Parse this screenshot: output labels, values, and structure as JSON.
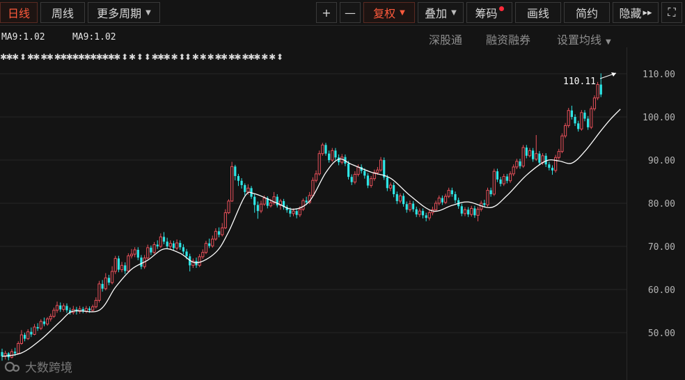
{
  "toolbar": {
    "tab_daily": "日线",
    "tab_weekly": "周线",
    "more_periods": "更多周期",
    "zoom_in": "+",
    "zoom_out": "—",
    "adjust": "复权",
    "overlay": "叠加",
    "chips": "筹码",
    "draw": "画线",
    "simple": "简约",
    "hide": "隐藏",
    "hide_arrow": "▸▸",
    "fullscreen": "⛶"
  },
  "indicator": {
    "ma_label_1": "MA9:1.02",
    "ma_label_2": "MA9:1.02"
  },
  "links": {
    "shenzhen_connect": "深股通",
    "margin_trading": "融资融券",
    "ma_settings": "设置均线"
  },
  "watermark": "大数跨境",
  "colors": {
    "background": "#141414",
    "up": "#e8505a",
    "down": "#2ee6e6",
    "ma_line": "#ffffff",
    "active": "#ff5a3c",
    "grid": "#262626"
  },
  "chart_data": {
    "type": "candlestick",
    "yticks": [
      "110.00",
      "100.00",
      "90.00",
      "80.00",
      "70.00",
      "60.00",
      "50.00"
    ],
    "ylim": [
      43,
      110
    ],
    "max_label": "110.11",
    "candles": [
      [
        45.5,
        44.5,
        46.3,
        43.5
      ],
      [
        44.5,
        45.2,
        45.8,
        43.8
      ],
      [
        45.2,
        44.3,
        45.5,
        43.6
      ],
      [
        44.3,
        45.6,
        46.2,
        44.0
      ],
      [
        45.6,
        45.2,
        46.5,
        44.6
      ],
      [
        45.2,
        47.5,
        48.0,
        45.0
      ],
      [
        47.5,
        49.5,
        50.6,
        47.2
      ],
      [
        49.5,
        48.6,
        50.0,
        48.0
      ],
      [
        48.6,
        50.2,
        50.8,
        48.3
      ],
      [
        50.2,
        49.6,
        51.2,
        49.0
      ],
      [
        49.6,
        51.3,
        52.0,
        49.4
      ],
      [
        51.3,
        51.0,
        52.2,
        50.4
      ],
      [
        51.0,
        52.6,
        53.1,
        50.6
      ],
      [
        52.6,
        52.0,
        53.5,
        51.5
      ],
      [
        52.0,
        53.2,
        53.6,
        51.6
      ],
      [
        53.2,
        53.8,
        54.4,
        52.6
      ],
      [
        53.8,
        55.2,
        55.8,
        53.4
      ],
      [
        55.2,
        56.3,
        57.2,
        54.6
      ],
      [
        56.3,
        55.4,
        57.0,
        54.8
      ],
      [
        55.4,
        56.2,
        56.8,
        54.9
      ],
      [
        56.2,
        55.2,
        56.8,
        54.6
      ],
      [
        55.2,
        54.7,
        55.8,
        54.2
      ],
      [
        54.7,
        55.4,
        56.2,
        54.2
      ],
      [
        55.4,
        54.9,
        56.0,
        54.2
      ],
      [
        54.9,
        55.5,
        56.2,
        54.4
      ],
      [
        55.5,
        55.0,
        56.0,
        54.5
      ],
      [
        55.0,
        55.6,
        56.2,
        54.5
      ],
      [
        55.6,
        55.2,
        56.1,
        54.6
      ],
      [
        55.2,
        56.0,
        56.5,
        54.8
      ],
      [
        56.0,
        57.5,
        58.2,
        55.6
      ],
      [
        57.5,
        61.3,
        62.0,
        57.0
      ],
      [
        61.3,
        60.2,
        62.2,
        59.5
      ],
      [
        60.2,
        62.7,
        63.8,
        59.8
      ],
      [
        62.7,
        61.6,
        63.4,
        61.0
      ],
      [
        61.6,
        64.2,
        65.4,
        61.2
      ],
      [
        64.2,
        67.2,
        67.8,
        63.6
      ],
      [
        67.2,
        64.6,
        67.8,
        64.0
      ],
      [
        64.6,
        65.6,
        66.4,
        64.0
      ],
      [
        65.6,
        64.3,
        66.3,
        63.6
      ],
      [
        64.3,
        67.8,
        68.4,
        64.0
      ],
      [
        67.8,
        68.2,
        69.4,
        67.2
      ],
      [
        68.2,
        69.2,
        69.8,
        67.5
      ],
      [
        69.2,
        67.4,
        69.8,
        66.8
      ],
      [
        67.4,
        65.3,
        68.0,
        64.7
      ],
      [
        65.3,
        67.3,
        68.0,
        64.8
      ],
      [
        67.3,
        69.7,
        70.4,
        67.0
      ],
      [
        69.7,
        68.6,
        70.2,
        68.0
      ],
      [
        68.6,
        70.4,
        71.0,
        68.2
      ],
      [
        70.4,
        70.0,
        71.4,
        69.4
      ],
      [
        70.0,
        72.2,
        73.0,
        69.6
      ],
      [
        72.2,
        71.1,
        73.3,
        70.5
      ],
      [
        71.1,
        70.0,
        72.0,
        69.4
      ],
      [
        70.0,
        70.7,
        71.4,
        69.4
      ],
      [
        70.7,
        69.6,
        71.3,
        69.0
      ],
      [
        69.6,
        70.8,
        71.6,
        69.1
      ],
      [
        70.8,
        69.8,
        71.4,
        69.2
      ],
      [
        69.8,
        68.8,
        70.5,
        68.2
      ],
      [
        68.8,
        67.7,
        69.4,
        67.0
      ],
      [
        67.7,
        65.6,
        68.3,
        64.2
      ],
      [
        65.6,
        66.6,
        67.2,
        65.0
      ],
      [
        66.6,
        65.6,
        67.4,
        65.0
      ],
      [
        65.6,
        67.6,
        68.2,
        65.2
      ],
      [
        67.6,
        68.6,
        69.3,
        67.1
      ],
      [
        68.6,
        70.7,
        71.3,
        68.2
      ],
      [
        70.7,
        70.1,
        71.8,
        69.6
      ],
      [
        70.1,
        71.7,
        72.5,
        69.7
      ],
      [
        71.7,
        73.5,
        74.2,
        71.3
      ],
      [
        73.5,
        72.7,
        74.4,
        72.1
      ],
      [
        72.7,
        74.3,
        75.4,
        72.3
      ],
      [
        74.3,
        77.8,
        78.6,
        74.0
      ],
      [
        77.8,
        80.5,
        80.9,
        77.5
      ],
      [
        80.5,
        88.5,
        89.6,
        80.3
      ],
      [
        88.5,
        86.3,
        88.9,
        85.3
      ],
      [
        86.3,
        85.2,
        86.8,
        84.0
      ],
      [
        85.2,
        84.2,
        85.8,
        83.4
      ],
      [
        84.2,
        82.6,
        84.6,
        81.8
      ],
      [
        82.6,
        83.5,
        84.4,
        82.0
      ],
      [
        83.5,
        81.5,
        84.0,
        81.0
      ],
      [
        81.5,
        79.6,
        82.1,
        77.8
      ],
      [
        79.6,
        78.2,
        80.4,
        76.4
      ],
      [
        78.2,
        79.8,
        80.6,
        77.7
      ],
      [
        79.8,
        81.2,
        81.8,
        79.4
      ],
      [
        81.2,
        79.4,
        81.6,
        78.8
      ],
      [
        79.4,
        80.1,
        81.0,
        79.0
      ],
      [
        80.1,
        81.5,
        82.6,
        79.6
      ],
      [
        81.5,
        79.5,
        82.1,
        79.0
      ],
      [
        79.5,
        80.5,
        81.0,
        78.5
      ],
      [
        80.5,
        79.1,
        81.0,
        78.5
      ],
      [
        79.1,
        78.4,
        79.6,
        77.8
      ],
      [
        78.4,
        77.6,
        79.0,
        76.8
      ],
      [
        77.6,
        78.2,
        78.8,
        77.0
      ],
      [
        78.2,
        77.3,
        78.8,
        76.5
      ],
      [
        77.3,
        78.6,
        79.3,
        76.8
      ],
      [
        78.6,
        80.6,
        81.1,
        78.2
      ],
      [
        80.6,
        80.2,
        81.5,
        79.6
      ],
      [
        80.2,
        81.8,
        82.6,
        79.8
      ],
      [
        81.8,
        85.3,
        86.0,
        81.4
      ],
      [
        85.3,
        86.8,
        87.6,
        84.8
      ],
      [
        86.8,
        91.5,
        92.2,
        86.4
      ],
      [
        91.5,
        93.5,
        94.0,
        91.0
      ],
      [
        93.5,
        91.5,
        94.0,
        91.0
      ],
      [
        91.5,
        90.0,
        92.2,
        89.4
      ],
      [
        90.0,
        92.2,
        92.8,
        89.6
      ],
      [
        92.2,
        90.6,
        92.8,
        90.0
      ],
      [
        90.6,
        89.5,
        91.3,
        88.8
      ],
      [
        89.5,
        90.7,
        91.4,
        89.0
      ],
      [
        90.7,
        89.2,
        91.3,
        88.6
      ],
      [
        89.2,
        86.1,
        89.8,
        85.5
      ],
      [
        86.1,
        84.9,
        86.7,
        84.2
      ],
      [
        84.9,
        86.7,
        87.4,
        84.4
      ],
      [
        86.7,
        88.4,
        89.0,
        86.2
      ],
      [
        88.4,
        87.5,
        89.0,
        86.9
      ],
      [
        87.5,
        86.4,
        88.1,
        85.7
      ],
      [
        86.4,
        84.1,
        87.0,
        83.5
      ],
      [
        84.1,
        85.7,
        86.3,
        83.6
      ],
      [
        85.7,
        87.1,
        87.8,
        85.2
      ],
      [
        87.1,
        87.7,
        88.4,
        86.6
      ],
      [
        87.7,
        90.0,
        90.7,
        87.3
      ],
      [
        90.0,
        86.0,
        90.6,
        85.4
      ],
      [
        86.0,
        83.5,
        86.6,
        82.8
      ],
      [
        83.5,
        84.2,
        84.8,
        82.8
      ],
      [
        84.2,
        82.1,
        84.8,
        81.4
      ],
      [
        82.1,
        80.5,
        82.7,
        79.8
      ],
      [
        80.5,
        81.7,
        82.3,
        80.0
      ],
      [
        81.7,
        79.8,
        82.3,
        79.2
      ],
      [
        79.8,
        78.5,
        80.4,
        77.8
      ],
      [
        78.5,
        79.9,
        80.6,
        78.0
      ],
      [
        79.9,
        78.6,
        80.5,
        78.0
      ],
      [
        78.6,
        77.4,
        79.2,
        76.8
      ],
      [
        77.4,
        78.2,
        78.8,
        76.8
      ],
      [
        78.2,
        77.2,
        78.8,
        76.5
      ],
      [
        77.2,
        76.6,
        77.8,
        75.8
      ],
      [
        76.6,
        77.8,
        78.5,
        76.0
      ],
      [
        77.8,
        78.5,
        79.2,
        77.2
      ],
      [
        78.5,
        80.0,
        80.6,
        78.0
      ],
      [
        80.0,
        81.2,
        81.8,
        79.5
      ],
      [
        81.2,
        80.2,
        81.8,
        79.6
      ],
      [
        80.2,
        81.6,
        82.2,
        79.8
      ],
      [
        81.6,
        83.0,
        83.6,
        81.2
      ],
      [
        83.0,
        82.1,
        83.6,
        81.5
      ],
      [
        82.1,
        80.7,
        82.7,
        80.0
      ],
      [
        80.7,
        79.3,
        81.3,
        78.7
      ],
      [
        79.3,
        77.6,
        79.9,
        77.0
      ],
      [
        77.6,
        78.5,
        79.1,
        77.0
      ],
      [
        78.5,
        77.4,
        79.1,
        76.8
      ],
      [
        77.4,
        78.8,
        79.4,
        76.9
      ],
      [
        78.8,
        77.2,
        79.4,
        76.6
      ],
      [
        77.2,
        78.6,
        79.2,
        75.8
      ],
      [
        78.6,
        80.0,
        80.6,
        78.1
      ],
      [
        80.0,
        79.6,
        80.8,
        79.0
      ],
      [
        79.6,
        83.0,
        83.6,
        79.2
      ],
      [
        83.0,
        82.1,
        83.6,
        81.5
      ],
      [
        82.1,
        87.4,
        88.0,
        81.7
      ],
      [
        87.4,
        85.5,
        88.0,
        84.9
      ],
      [
        85.5,
        84.5,
        86.1,
        83.9
      ],
      [
        84.5,
        86.2,
        86.8,
        84.0
      ],
      [
        86.2,
        85.2,
        86.8,
        84.6
      ],
      [
        85.2,
        86.8,
        87.4,
        84.7
      ],
      [
        86.8,
        88.4,
        89.0,
        86.3
      ],
      [
        88.4,
        89.7,
        90.3,
        87.9
      ],
      [
        89.7,
        88.6,
        90.3,
        88.0
      ],
      [
        88.6,
        92.9,
        93.5,
        88.2
      ],
      [
        92.9,
        91.0,
        93.5,
        90.4
      ],
      [
        91.0,
        92.2,
        92.8,
        90.6
      ],
      [
        92.2,
        90.2,
        92.8,
        89.6
      ],
      [
        90.2,
        91.5,
        95.8,
        89.8
      ],
      [
        91.5,
        89.4,
        92.1,
        88.8
      ],
      [
        89.4,
        91.0,
        91.6,
        88.9
      ],
      [
        91.0,
        89.0,
        91.6,
        88.4
      ],
      [
        89.0,
        88.2,
        89.6,
        87.6
      ],
      [
        88.2,
        87.6,
        88.8,
        86.6
      ],
      [
        87.6,
        90.6,
        91.2,
        87.1
      ],
      [
        90.6,
        92.0,
        92.6,
        90.1
      ],
      [
        92.0,
        95.6,
        96.2,
        91.6
      ],
      [
        95.6,
        98.0,
        98.6,
        95.1
      ],
      [
        98.0,
        101.5,
        102.1,
        97.5
      ],
      [
        101.5,
        100.0,
        102.6,
        99.4
      ],
      [
        100.0,
        98.5,
        100.6,
        97.9
      ],
      [
        98.5,
        97.2,
        99.1,
        96.6
      ],
      [
        97.2,
        101.0,
        101.6,
        96.8
      ],
      [
        101.0,
        99.6,
        101.6,
        99.0
      ],
      [
        99.6,
        97.6,
        100.2,
        97.0
      ],
      [
        97.6,
        101.9,
        102.5,
        97.2
      ],
      [
        101.9,
        104.4,
        105.0,
        101.4
      ],
      [
        104.4,
        107.5,
        108.1,
        103.9
      ],
      [
        107.5,
        105.2,
        110.1,
        104.6
      ]
    ],
    "ma_label": "MA9",
    "ma": [
      [
        0,
        44.5
      ],
      [
        6,
        45.3
      ],
      [
        12,
        48.4
      ],
      [
        18,
        52.6
      ],
      [
        22,
        55.0
      ],
      [
        30,
        55.2
      ],
      [
        35,
        60.5
      ],
      [
        40,
        64.7
      ],
      [
        45,
        66.8
      ],
      [
        50,
        69.4
      ],
      [
        55,
        68.4
      ],
      [
        60,
        66.2
      ],
      [
        66,
        68.6
      ],
      [
        70,
        73.4
      ],
      [
        75,
        81.6
      ],
      [
        78,
        82.2
      ],
      [
        85,
        80.0
      ],
      [
        90,
        78.6
      ],
      [
        95,
        80.5
      ],
      [
        100,
        87.1
      ],
      [
        104,
        90.2
      ],
      [
        108,
        89.0
      ],
      [
        114,
        87.2
      ],
      [
        120,
        85.8
      ],
      [
        126,
        81.8
      ],
      [
        133,
        78.2
      ],
      [
        139,
        79.5
      ],
      [
        144,
        80.3
      ],
      [
        151,
        79.0
      ],
      [
        156,
        81.8
      ],
      [
        162,
        86.5
      ],
      [
        168,
        89.8
      ],
      [
        172,
        89.8
      ],
      [
        176,
        89.3
      ],
      [
        180,
        92.0
      ],
      [
        185,
        96.8
      ],
      [
        188,
        99.5
      ],
      [
        191,
        101.8
      ]
    ],
    "markers_top": "✱✱✱ ⬍ ✱✱ ✱✱ ✱✱✱✱✱✱✱✱✱✱✱ ⬍ ✱ ⬍ ⬍ ✱✱✱ ✱ ⬍⬍ ✱ ✱ ✱ ✱✱ ✱✱ ✱✱✱ ✱ ✱ ⬍"
  }
}
